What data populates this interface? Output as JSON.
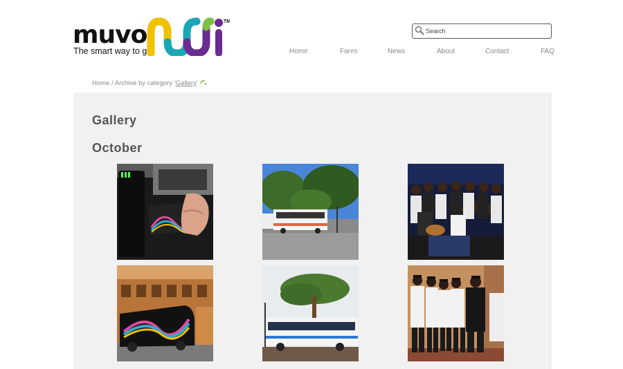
{
  "logo": {
    "wordmark": "muvo",
    "tagline": "The smart way to go",
    "trademark": "TM"
  },
  "search": {
    "placeholder": "Search",
    "value": ""
  },
  "nav": [
    "Home",
    "Fares",
    "News",
    "About",
    "Contact",
    "FAQ"
  ],
  "breadcrumb": {
    "home": "Home",
    "separator": " / ",
    "archive_prefix": "Archive by category '",
    "category": "Gallery",
    "suffix": "'"
  },
  "page": {
    "title": "Gallery",
    "section": "October"
  },
  "gallery": [
    {
      "subject": "card-reader-photo"
    },
    {
      "subject": "bus-street-photo"
    },
    {
      "subject": "choir-group-photo"
    },
    {
      "subject": "muvo-van-photo"
    },
    {
      "subject": "bus-tree-photo"
    },
    {
      "subject": "team-photo"
    }
  ],
  "colors": {
    "panel_bg": "#f1f1f1",
    "nav_text": "#888888",
    "title_text": "#555555",
    "brand_yellow": "#f2c200",
    "brand_teal": "#1aa6b7",
    "brand_purple": "#6a2c91",
    "brand_green": "#7ac143"
  }
}
